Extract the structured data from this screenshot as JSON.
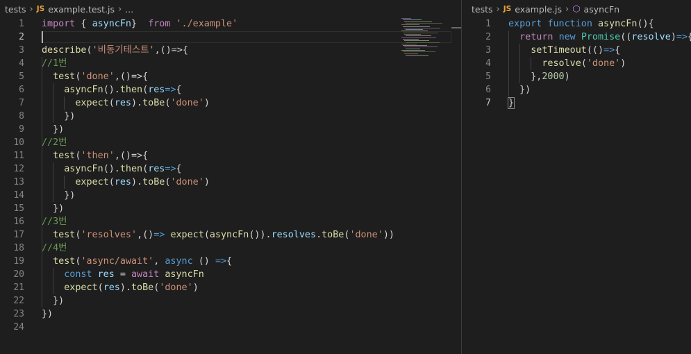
{
  "left_editor": {
    "breadcrumb": {
      "folder": "tests",
      "file_badge": "JS",
      "file": "example.test.js",
      "symbol": "..."
    },
    "current_line": 2,
    "lines": [
      {
        "n": "1",
        "tokens": [
          [
            "kwc",
            "import"
          ],
          [
            "p",
            " { "
          ],
          [
            "var",
            "asyncFn"
          ],
          [
            "p",
            "}  "
          ],
          [
            "kwc",
            "from"
          ],
          [
            "p",
            " "
          ],
          [
            "str",
            "'./example'"
          ]
        ]
      },
      {
        "n": "2",
        "tokens": []
      },
      {
        "n": "3",
        "tokens": [
          [
            "fn",
            "describe"
          ],
          [
            "p",
            "("
          ],
          [
            "str",
            "'비동기테스트'"
          ],
          [
            "p",
            ",()=>{"
          ]
        ]
      },
      {
        "n": "4",
        "tokens": [
          [
            "cmt",
            "//1번"
          ]
        ]
      },
      {
        "n": "5",
        "tokens": [
          [
            "p",
            "  "
          ],
          [
            "fn",
            "test"
          ],
          [
            "p",
            "("
          ],
          [
            "str",
            "'done'"
          ],
          [
            "p",
            ",()=>{"
          ]
        ]
      },
      {
        "n": "6",
        "tokens": [
          [
            "p",
            "    "
          ],
          [
            "fn",
            "asyncFn"
          ],
          [
            "p",
            "()."
          ],
          [
            "fn",
            "then"
          ],
          [
            "p",
            "("
          ],
          [
            "var",
            "res"
          ],
          [
            "kw",
            "=>"
          ],
          [
            "p",
            "{"
          ]
        ]
      },
      {
        "n": "7",
        "tokens": [
          [
            "p",
            "      "
          ],
          [
            "fn",
            "expect"
          ],
          [
            "p",
            "("
          ],
          [
            "var",
            "res"
          ],
          [
            "p",
            ")."
          ],
          [
            "fn",
            "toBe"
          ],
          [
            "p",
            "("
          ],
          [
            "str",
            "'done'"
          ],
          [
            "p",
            ")"
          ]
        ]
      },
      {
        "n": "8",
        "tokens": [
          [
            "p",
            "    })"
          ]
        ]
      },
      {
        "n": "9",
        "tokens": [
          [
            "p",
            "  })"
          ]
        ]
      },
      {
        "n": "10",
        "tokens": [
          [
            "cmt",
            "//2번"
          ]
        ]
      },
      {
        "n": "11",
        "tokens": [
          [
            "p",
            "  "
          ],
          [
            "fn",
            "test"
          ],
          [
            "p",
            "("
          ],
          [
            "str",
            "'then'"
          ],
          [
            "p",
            ",()=>{"
          ]
        ]
      },
      {
        "n": "12",
        "tokens": [
          [
            "p",
            "    "
          ],
          [
            "fn",
            "asyncFn"
          ],
          [
            "p",
            "()."
          ],
          [
            "fn",
            "then"
          ],
          [
            "p",
            "("
          ],
          [
            "var",
            "res"
          ],
          [
            "kw",
            "=>"
          ],
          [
            "p",
            "{"
          ]
        ]
      },
      {
        "n": "13",
        "tokens": [
          [
            "p",
            "      "
          ],
          [
            "fn",
            "expect"
          ],
          [
            "p",
            "("
          ],
          [
            "var",
            "res"
          ],
          [
            "p",
            ")."
          ],
          [
            "fn",
            "toBe"
          ],
          [
            "p",
            "("
          ],
          [
            "str",
            "'done'"
          ],
          [
            "p",
            ")"
          ]
        ]
      },
      {
        "n": "14",
        "tokens": [
          [
            "p",
            "    })"
          ]
        ]
      },
      {
        "n": "15",
        "tokens": [
          [
            "p",
            "  })"
          ]
        ]
      },
      {
        "n": "16",
        "tokens": [
          [
            "cmt",
            "//3번"
          ]
        ]
      },
      {
        "n": "17",
        "tokens": [
          [
            "p",
            "  "
          ],
          [
            "fn",
            "test"
          ],
          [
            "p",
            "("
          ],
          [
            "str",
            "'resolves'"
          ],
          [
            "p",
            ","
          ],
          [
            "p",
            "()"
          ],
          [
            "kw",
            "=>"
          ],
          [
            "p",
            " "
          ],
          [
            "fn",
            "expect"
          ],
          [
            "p",
            "("
          ],
          [
            "fn",
            "asyncFn"
          ],
          [
            "p",
            "())."
          ],
          [
            "var",
            "resolves"
          ],
          [
            "p",
            "."
          ],
          [
            "fn",
            "toBe"
          ],
          [
            "p",
            "("
          ],
          [
            "str",
            "'done'"
          ],
          [
            "p",
            "))"
          ]
        ]
      },
      {
        "n": "18",
        "tokens": [
          [
            "cmt",
            "//4번"
          ]
        ]
      },
      {
        "n": "19",
        "tokens": [
          [
            "p",
            "  "
          ],
          [
            "fn",
            "test"
          ],
          [
            "p",
            "("
          ],
          [
            "str",
            "'async/await'"
          ],
          [
            "p",
            ", "
          ],
          [
            "kw",
            "async"
          ],
          [
            "p",
            " () "
          ],
          [
            "kw",
            "=>"
          ],
          [
            "p",
            "{"
          ]
        ]
      },
      {
        "n": "20",
        "tokens": [
          [
            "p",
            "    "
          ],
          [
            "kw",
            "const"
          ],
          [
            "p",
            " "
          ],
          [
            "var",
            "res"
          ],
          [
            "p",
            " = "
          ],
          [
            "kwc",
            "await"
          ],
          [
            "p",
            " "
          ],
          [
            "fn",
            "asyncFn"
          ]
        ]
      },
      {
        "n": "21",
        "tokens": [
          [
            "p",
            "    "
          ],
          [
            "fn",
            "expect"
          ],
          [
            "p",
            "("
          ],
          [
            "var",
            "res"
          ],
          [
            "p",
            ")."
          ],
          [
            "fn",
            "toBe"
          ],
          [
            "p",
            "("
          ],
          [
            "str",
            "'done'"
          ],
          [
            "p",
            ")"
          ]
        ]
      },
      {
        "n": "22",
        "tokens": [
          [
            "p",
            "  })"
          ]
        ]
      },
      {
        "n": "23",
        "tokens": [
          [
            "p",
            "})"
          ]
        ]
      },
      {
        "n": "24",
        "tokens": []
      }
    ]
  },
  "right_editor": {
    "breadcrumb": {
      "folder": "tests",
      "file_badge": "JS",
      "file": "example.js",
      "symbol": "asyncFn"
    },
    "current_line": 7,
    "lines": [
      {
        "n": "1",
        "tokens": [
          [
            "kw",
            "export"
          ],
          [
            "p",
            " "
          ],
          [
            "kw",
            "function"
          ],
          [
            "p",
            " "
          ],
          [
            "fn",
            "asyncFn"
          ],
          [
            "p",
            "(){"
          ]
        ]
      },
      {
        "n": "2",
        "tokens": [
          [
            "p",
            "  "
          ],
          [
            "kwc",
            "return"
          ],
          [
            "p",
            " "
          ],
          [
            "kw",
            "new"
          ],
          [
            "p",
            " "
          ],
          [
            "cls",
            "Promise"
          ],
          [
            "p",
            "(("
          ],
          [
            "var",
            "resolve"
          ],
          [
            "p",
            ")"
          ],
          [
            "kw",
            "=>"
          ],
          [
            "p",
            "{"
          ]
        ]
      },
      {
        "n": "3",
        "tokens": [
          [
            "p",
            "    "
          ],
          [
            "fn",
            "setTimeout"
          ],
          [
            "p",
            "(()"
          ],
          [
            "kw",
            "=>"
          ],
          [
            "p",
            "{"
          ]
        ]
      },
      {
        "n": "4",
        "tokens": [
          [
            "p",
            "      "
          ],
          [
            "fn",
            "resolve"
          ],
          [
            "p",
            "("
          ],
          [
            "str",
            "'done'"
          ],
          [
            "p",
            ")"
          ]
        ]
      },
      {
        "n": "5",
        "tokens": [
          [
            "p",
            "    },"
          ],
          [
            "num",
            "2000"
          ],
          [
            "p",
            ")"
          ]
        ]
      },
      {
        "n": "6",
        "tokens": [
          [
            "p",
            "  })"
          ]
        ]
      },
      {
        "n": "7",
        "tokens": [
          [
            "p",
            "}"
          ]
        ]
      }
    ]
  }
}
